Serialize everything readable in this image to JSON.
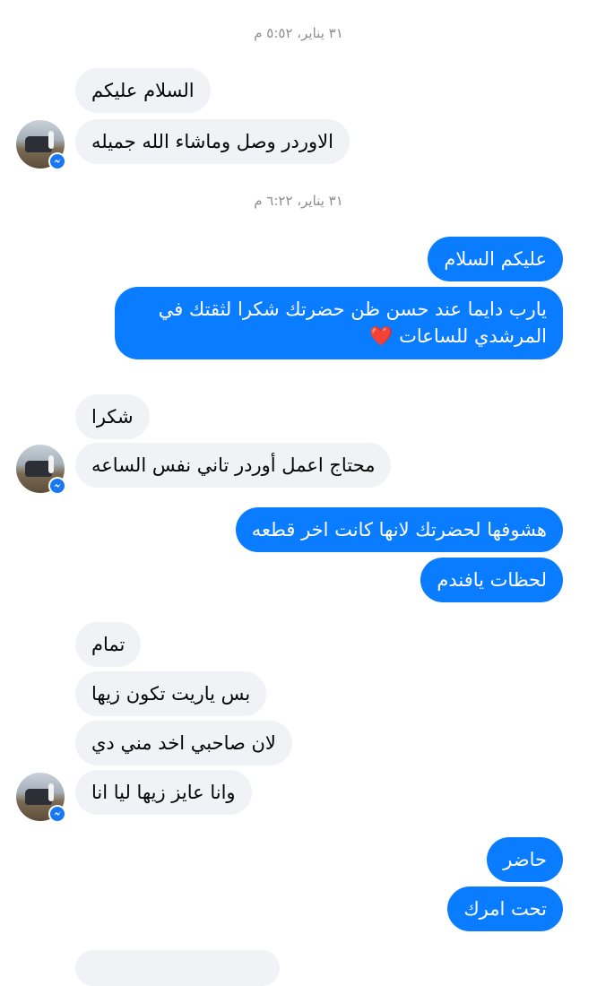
{
  "timestamps": [
    "٣١ يناير، ٥:٥٢ م",
    "٣١ يناير، ٦:٢٢ م"
  ],
  "messages": {
    "in1": "السلام عليكم",
    "in2": "الاوردر وصل وماشاء الله جميله",
    "out1": "عليكم السلام",
    "out2": "يارب دايما عند حسن ظن حضرتك شكرا لثقتك في المرشدي للساعات ❤️",
    "in3": "شكرا",
    "in4": "محتاج اعمل أوردر تاني نفس الساعه",
    "out3": "هشوفها لحضرتك لانها كانت اخر قطعه",
    "out4": "لحظات يافندم",
    "in5": "تمام",
    "in6": "بس ياريت تكون زيها",
    "in7": "لان صاحبي اخد مني دي",
    "in8": "وانا عايز زيها ليا انا",
    "out5": "حاضر",
    "out6": "تحت امرك"
  },
  "colors": {
    "incoming_bubble": "#f0f2f5",
    "outgoing_bubble": "#0a7cff",
    "timestamp": "#8a8d91",
    "messenger_badge": "#1877f2"
  },
  "icons": {
    "avatar": "contact-avatar",
    "badge": "messenger-icon"
  }
}
